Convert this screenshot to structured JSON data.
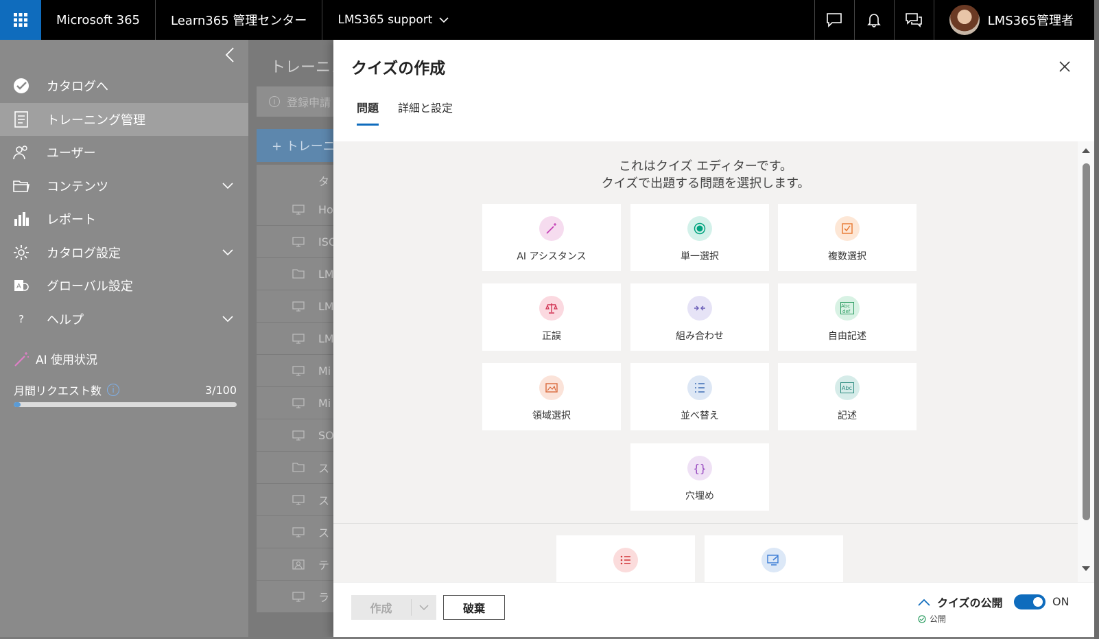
{
  "topbar": {
    "app_name": "Microsoft 365",
    "admin_center": "Learn365 管理センター",
    "tenant": "LMS365 support",
    "user_name": "LMS365管理者"
  },
  "sidebar": {
    "items": [
      {
        "label": "カタログへ",
        "icon": "catalog-check-icon"
      },
      {
        "label": "トレーニング管理",
        "icon": "training-doc-icon",
        "active": true
      },
      {
        "label": "ユーザー",
        "icon": "users-icon"
      },
      {
        "label": "コンテンツ",
        "icon": "folder-icon",
        "expandable": true
      },
      {
        "label": "レポート",
        "icon": "bar-chart-icon"
      },
      {
        "label": "カタログ設定",
        "icon": "gear-icon",
        "expandable": true
      },
      {
        "label": "グローバル設定",
        "icon": "global-settings-icon"
      },
      {
        "label": "ヘルプ",
        "icon": "help-icon",
        "expandable": true
      }
    ],
    "ai_usage_label": "AI 使用状況",
    "monthly_requests_label": "月間リクエスト数",
    "monthly_requests_value": "3/100",
    "monthly_requests_fraction": 0.03
  },
  "main": {
    "title": "トレーニン",
    "notice": "登録申請",
    "new_button": "+ トレーニ",
    "column_header": "タ",
    "rows": [
      {
        "text": "Ho",
        "icon": "monitor-icon"
      },
      {
        "text": "ISO",
        "icon": "monitor-icon"
      },
      {
        "text": "LM",
        "icon": "folder-icon"
      },
      {
        "text": "LM",
        "icon": "monitor-icon"
      },
      {
        "text": "LM",
        "icon": "monitor-icon"
      },
      {
        "text": "Mi",
        "icon": "monitor-icon"
      },
      {
        "text": "Mi",
        "icon": "monitor-icon"
      },
      {
        "text": "SO",
        "icon": "monitor-icon"
      },
      {
        "text": "ス",
        "icon": "folder-icon"
      },
      {
        "text": "ス",
        "icon": "monitor-icon"
      },
      {
        "text": "ス",
        "icon": "monitor-icon"
      },
      {
        "text": "テ",
        "icon": "classroom-icon"
      },
      {
        "text": "ラ",
        "icon": "monitor-icon"
      }
    ]
  },
  "panel": {
    "title": "クイズの作成",
    "tabs": [
      "問題",
      "詳細と設定"
    ],
    "intro_line1": "これはクイズ エディターです。",
    "intro_line2": "クイズで出題する問題を選択します。",
    "question_types": [
      {
        "label": "AI アシスタンス",
        "icon": "magic-wand-icon",
        "color": "#f6dcef",
        "fg": "#c239b3"
      },
      {
        "label": "単一選択",
        "icon": "radio-button-icon",
        "color": "#d3f1ea",
        "fg": "#00a37f"
      },
      {
        "label": "複数選択",
        "icon": "checkbox-icon",
        "color": "#fde7d6",
        "fg": "#e8772e"
      },
      {
        "label": "正誤",
        "icon": "scales-icon",
        "color": "#fbd9e0",
        "fg": "#d13454"
      },
      {
        "label": "組み合わせ",
        "icon": "match-arrows-icon",
        "color": "#e6e3f6",
        "fg": "#6b5fb8"
      },
      {
        "label": "自由記述",
        "icon": "text-abc-icon",
        "color": "#d8f2e4",
        "fg": "#2e9e63"
      },
      {
        "label": "領域選択",
        "icon": "image-region-icon",
        "color": "#fbe3d9",
        "fg": "#d9693c"
      },
      {
        "label": "並べ替え",
        "icon": "ordered-list-icon",
        "color": "#dde7f5",
        "fg": "#3f6fb5"
      },
      {
        "label": "記述",
        "icon": "abc-box-icon",
        "color": "#d6ece9",
        "fg": "#2b8a7e"
      },
      {
        "label": "穴埋め",
        "icon": "braces-icon",
        "color": "#efe1f5",
        "fg": "#9b4fc2"
      }
    ],
    "bottom_cards": [
      {
        "icon": "list-bullets-icon",
        "color": "#fbdcdc",
        "fg": "#d13438"
      },
      {
        "icon": "screen-edit-icon",
        "color": "#dce8f7",
        "fg": "#3a7bd5"
      }
    ]
  },
  "footer": {
    "create_label": "作成",
    "discard_label": "破棄",
    "publish_label": "クイズの公開",
    "publish_status": "公開",
    "toggle_label": "ON"
  }
}
